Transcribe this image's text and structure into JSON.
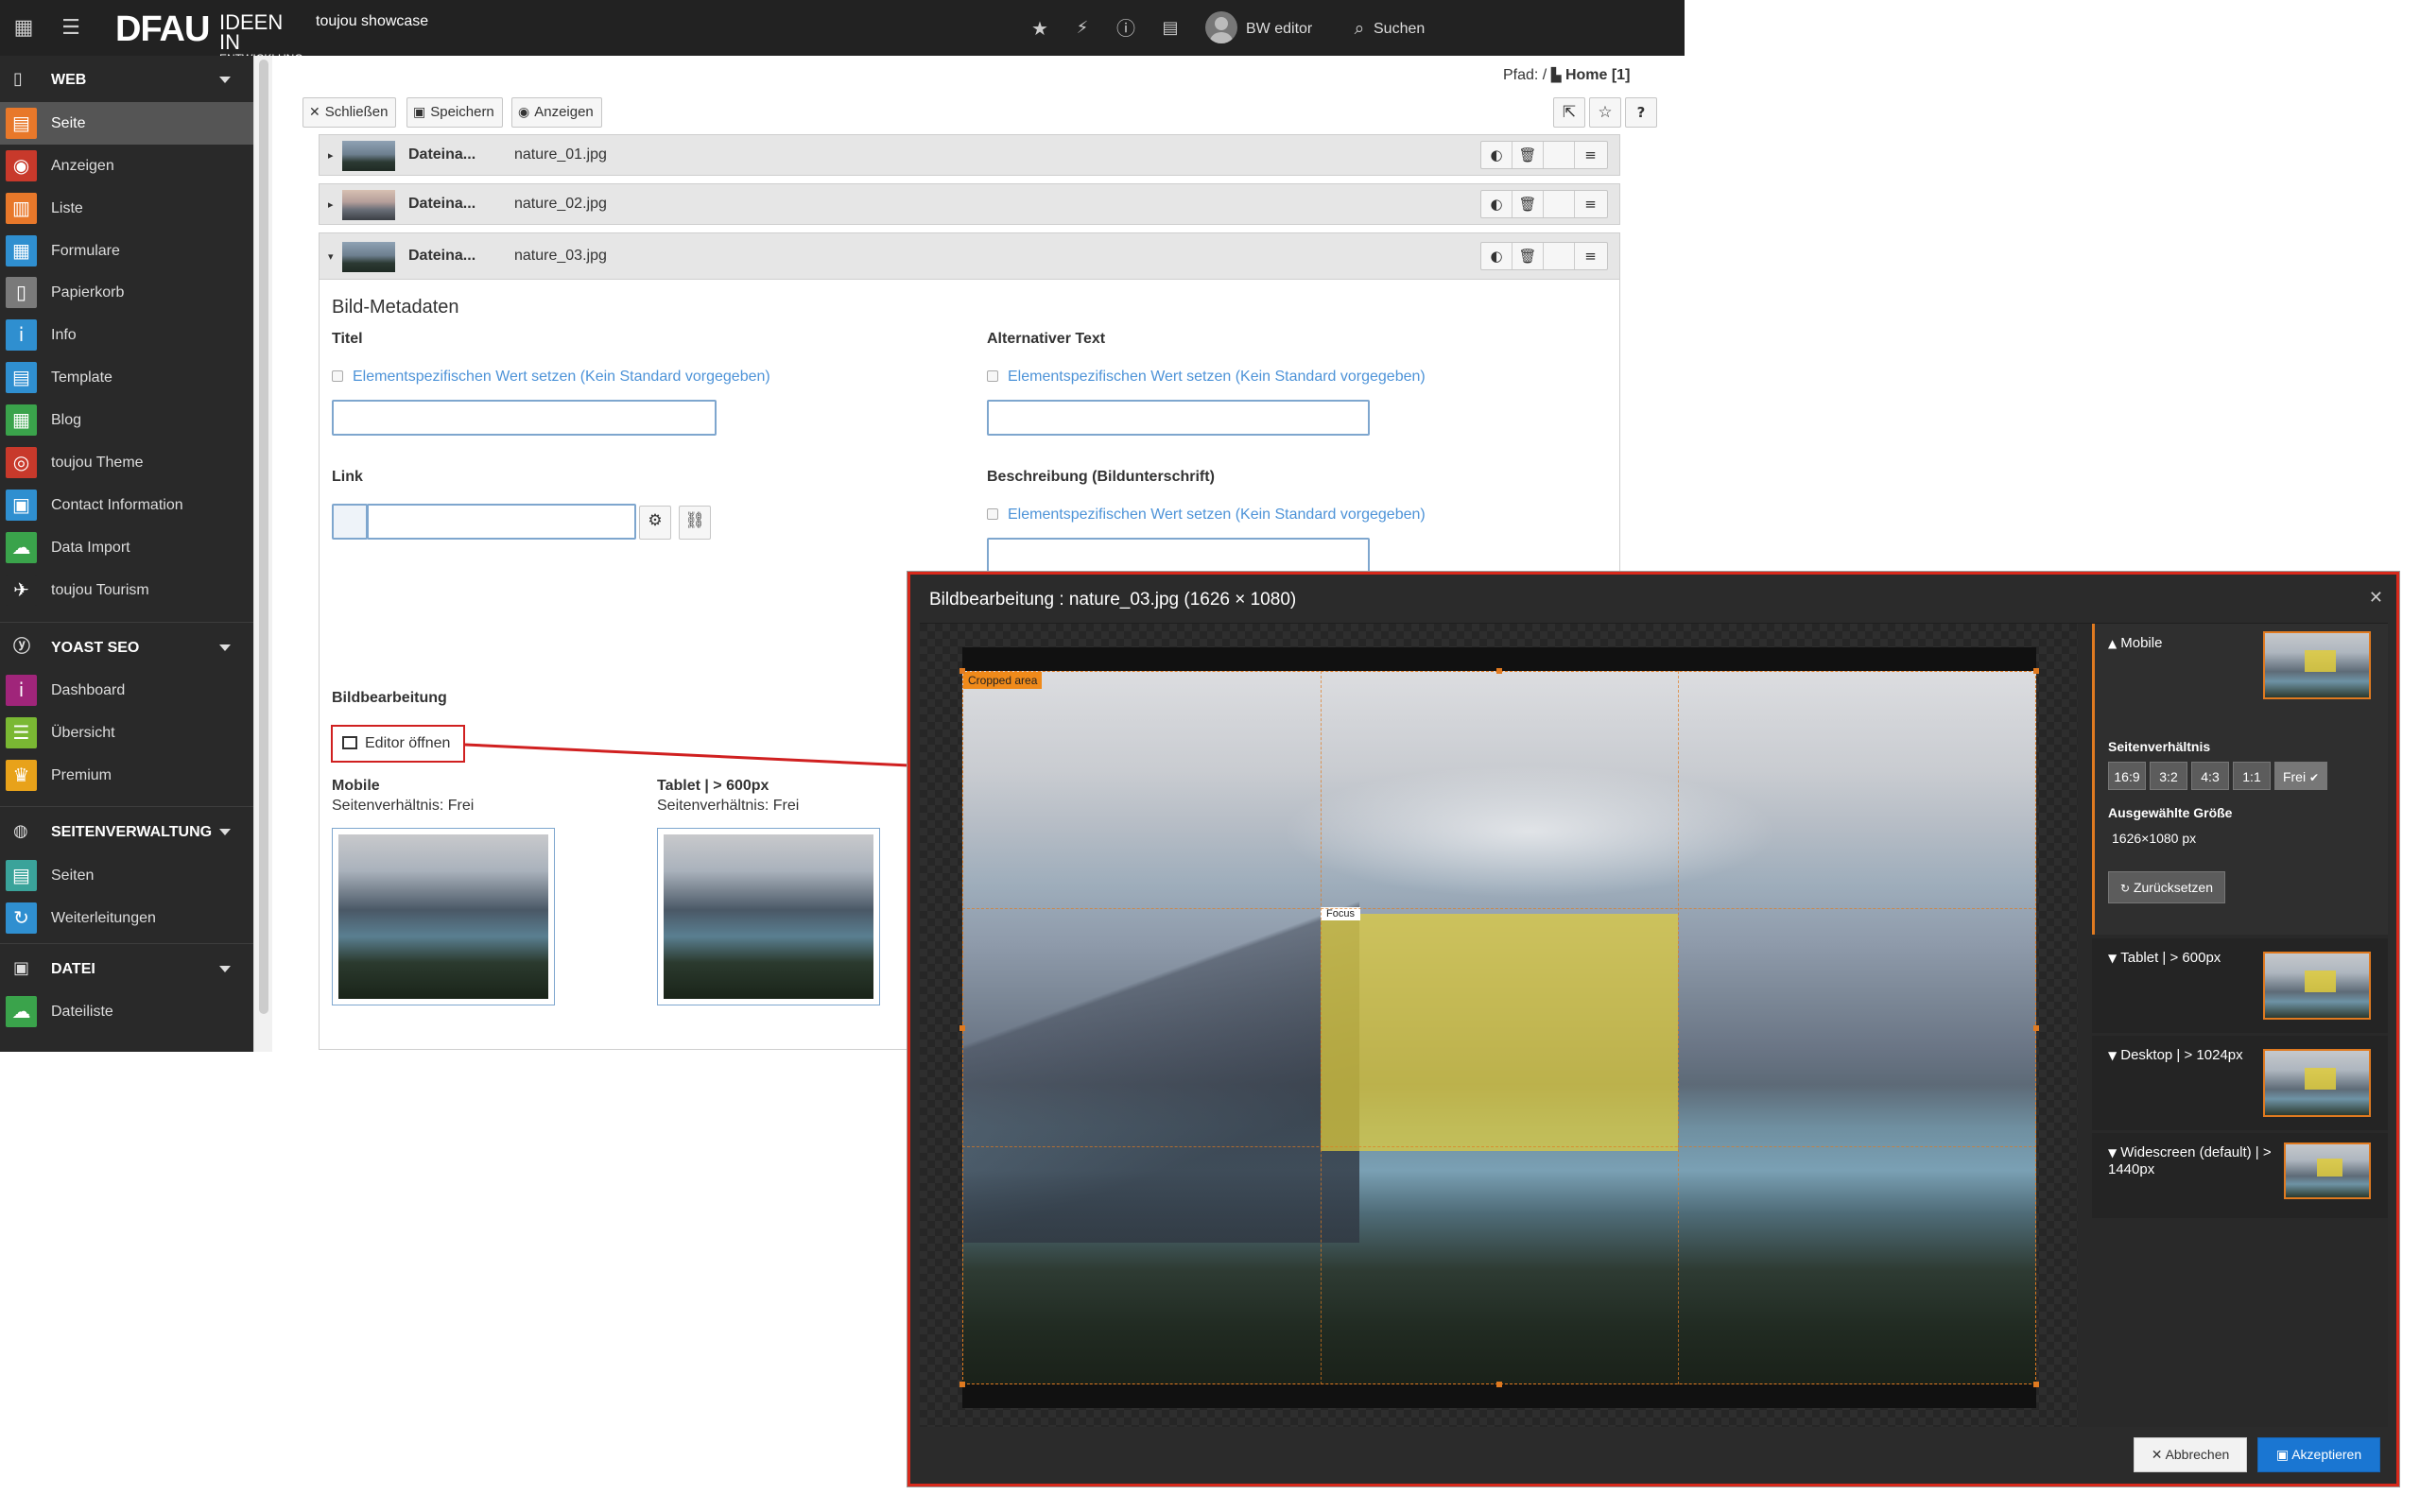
{
  "topbar": {
    "logo": "DFAU",
    "logo_tag_1": "IDEEN IN",
    "logo_tag_2": "ENTWICKLUNG",
    "site_name": "toujou showcase",
    "user_name": "BW editor",
    "search_label": "Suchen"
  },
  "sidebar": {
    "categories": [
      {
        "label": "WEB"
      },
      {
        "label": "YOAST SEO"
      },
      {
        "label": "SEITENVERWALTUNG"
      },
      {
        "label": "DATEI"
      }
    ],
    "items": [
      {
        "label": "Seite",
        "color": "#e8782a"
      },
      {
        "label": "Anzeigen",
        "color": "#c8392b"
      },
      {
        "label": "Liste",
        "color": "#e8782a"
      },
      {
        "label": "Formulare",
        "color": "#2f8fd0"
      },
      {
        "label": "Papierkorb",
        "color": "#7a7a7a"
      },
      {
        "label": "Info",
        "color": "#2f8fd0"
      },
      {
        "label": "Template",
        "color": "#2f8fd0"
      },
      {
        "label": "Blog",
        "color": "#3aa34b"
      },
      {
        "label": "toujou Theme",
        "color": "#c8392b"
      },
      {
        "label": "Contact Information",
        "color": "#2f8fd0"
      },
      {
        "label": "Data Import",
        "color": "#3aa34b"
      },
      {
        "label": "toujou Tourism",
        "color": "#292929"
      },
      {
        "label": "Dashboard",
        "color": "#a0257a"
      },
      {
        "label": "Übersicht",
        "color": "#7ab833"
      },
      {
        "label": "Premium",
        "color": "#e8a21a"
      },
      {
        "label": "Seiten",
        "color": "#3aa39a"
      },
      {
        "label": "Weiterleitungen",
        "color": "#2f8fd0"
      },
      {
        "label": "Dateiliste",
        "color": "#3aa34b"
      }
    ]
  },
  "docheader": {
    "path_label": "Pfad: /",
    "path_page": "Home [1]",
    "close_label": "Schließen",
    "save_label": "Speichern",
    "view_label": "Anzeigen"
  },
  "files": [
    {
      "label": "Dateina...",
      "name": "nature_01.jpg"
    },
    {
      "label": "Dateina...",
      "name": "nature_02.jpg"
    },
    {
      "label": "Dateina...",
      "name": "nature_03.jpg"
    }
  ],
  "meta": {
    "heading": "Bild-Metadaten",
    "title_label": "Titel",
    "alt_label": "Alternativer Text",
    "link_label": "Link",
    "desc_label": "Beschreibung (Bildunterschrift)",
    "override_text": "Elementspezifischen Wert setzen (Kein Standard vorgegeben)",
    "crop_heading": "Bildbearbeitung",
    "editor_btn": "Editor öffnen",
    "previews": [
      {
        "title": "Mobile",
        "ratio": "Seitenverhältnis: Frei"
      },
      {
        "title": "Tablet | > 600px",
        "ratio": "Seitenverhältnis: Frei"
      }
    ]
  },
  "modal": {
    "title": "Bildbearbeitung : nature_03.jpg (1626 × 1080)",
    "cropped_tag": "Cropped area",
    "focus_tag": "Focus",
    "variants": [
      {
        "label": "Mobile"
      },
      {
        "label": "Tablet | > 600px"
      },
      {
        "label": "Desktop | > 1024px"
      },
      {
        "label": "Widescreen (default) | > 1440px"
      }
    ],
    "ratio_heading": "Seitenverhältnis",
    "ratios": [
      "16:9",
      "3:2",
      "4:3",
      "1:1",
      "Frei"
    ],
    "selected_ratio": "Frei",
    "size_heading": "Ausgewählte Größe",
    "size_value": "1626×1080 px",
    "reset_label": "Zurücksetzen",
    "cancel_label": "Abbrechen",
    "accept_label": "Akzeptieren"
  }
}
